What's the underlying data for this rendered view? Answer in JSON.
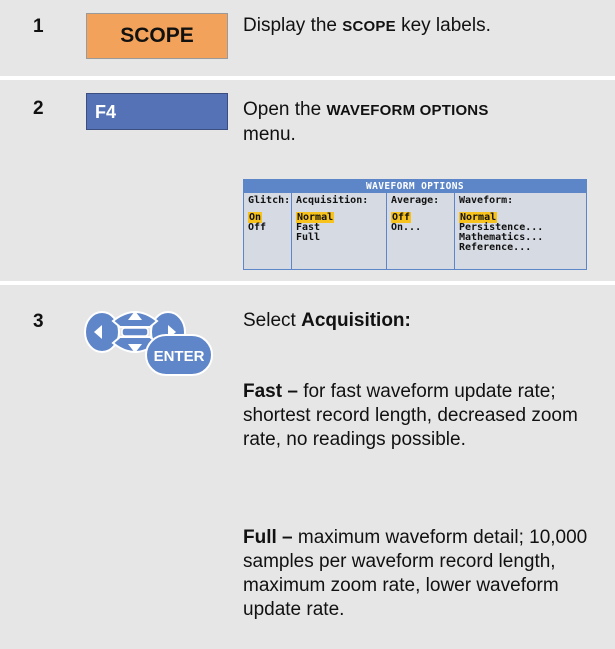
{
  "steps": [
    {
      "number": "1",
      "key_label": "SCOPE",
      "text_before": "Display the ",
      "text_key": "SCOPE",
      "text_after": " key labels."
    },
    {
      "number": "2",
      "key_label": "F4",
      "text_before": "Open the ",
      "text_key": "WAVEFORM OPTIONS",
      "text_after": " menu."
    },
    {
      "number": "3",
      "key_label": "ENTER",
      "select_prefix": "Select ",
      "select_bold": "Acquisition:",
      "fast_term": "Fast –",
      "fast_text": " for fast waveform update rate; shortest record length, decreased zoom rate, no readings possible.",
      "full_term": "Full –",
      "full_text": " maximum waveform detail; 10,000 samples per waveform record length, maximum zoom rate, lower waveform update rate."
    }
  ],
  "menu": {
    "title": "WAVEFORM OPTIONS",
    "columns": [
      {
        "header": "Glitch:",
        "options": [
          "On",
          "Off"
        ],
        "selected": 0
      },
      {
        "header": "Acquisition:",
        "options": [
          "Normal",
          "Fast",
          "Full"
        ],
        "selected": 0
      },
      {
        "header": "Average:",
        "options": [
          "Off",
          "On..."
        ],
        "selected": 0
      },
      {
        "header": "Waveform:",
        "options": [
          "Normal",
          "Persistence...",
          "Mathematics...",
          "Reference..."
        ],
        "selected": 0
      }
    ]
  },
  "colors": {
    "scope_key": "#f2a25b",
    "f4_key": "#5472b5",
    "menu_accent": "#5c86c8",
    "selection": "#f6c21b",
    "pad_blue": "#5f86c8",
    "panel_bg": "#e6e6e6"
  },
  "icons": [
    "navigation-pad-icon"
  ]
}
